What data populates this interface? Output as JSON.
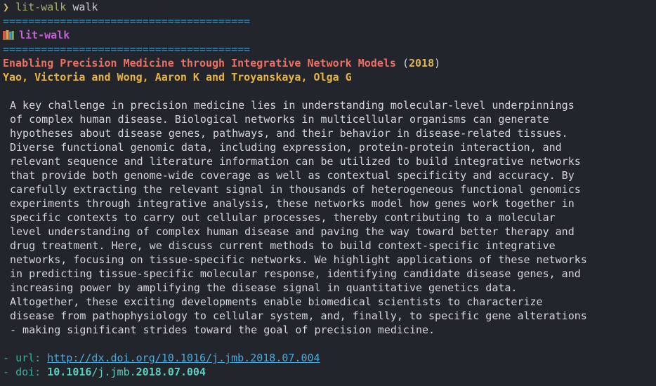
{
  "prompt": {
    "symbol": "❯",
    "command": "lit-walk",
    "argument": "walk"
  },
  "rule": "=======================================",
  "app": {
    "icon": "books-icon",
    "name": "lit-walk"
  },
  "paper": {
    "title": "Enabling Precision Medicine through Integrative Network Models",
    "year_open": "(",
    "year": "2018",
    "year_close": ")",
    "authors": "Yao, Victoria and Wong, Aaron K and Troyanskaya, Olga G",
    "abstract_lines": [
      "A key challenge in precision medicine lies in understanding molecular-level underpinnings",
      "of complex human disease. Biological networks in multicellular organisms can generate",
      "hypotheses about disease genes, pathways, and their behavior in disease-related tissues.",
      "Diverse functional genomic data, including expression, protein-protein interaction, and",
      "relevant sequence and literature information can be utilized to build integrative networks",
      "that provide both genome-wide coverage as well as contextual specificity and accuracy. By",
      "carefully extracting the relevant signal in thousands of heterogeneous functional genomics",
      "experiments through integrative analysis, these networks model how genes work together in",
      "specific contexts to carry out cellular processes, thereby contributing to a molecular",
      "level understanding of complex human disease and paving the way toward better therapy and",
      "drug treatment. Here, we discuss current methods to build context-specific integrative",
      "networks, focusing on tissue-specific networks. We highlight applications of these networks",
      "in predicting tissue-specific molecular response, identifying candidate disease genes, and",
      "increasing power by amplifying the disease signal in quantitative genetics data.",
      "Altogether, these exciting developments enable biomedical scientists to characterize",
      "disease from pathophysiology to cellular system, and, finally, to specific gene alterations",
      "- making significant strides toward the goal of precision medicine."
    ],
    "meta": {
      "dash": "-",
      "url_key": "url:",
      "url_value": "http://dx.doi.org/10.1016/j.jmb.2018.07.004",
      "doi_key": "doi:",
      "doi_part1": "10.1016",
      "doi_part2": "/j.jmb.",
      "doi_part3": "2018.07.004"
    }
  }
}
